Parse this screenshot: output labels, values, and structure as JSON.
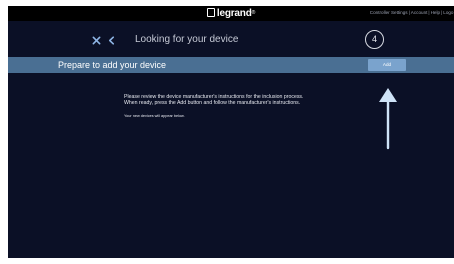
{
  "brand": {
    "name": "legrand",
    "registered_mark": "®"
  },
  "top_links": {
    "items": [
      "Controller Settings",
      "Account",
      "Help",
      "Logo"
    ],
    "separator": "|"
  },
  "header": {
    "close_icon": "close-icon",
    "back_icon": "chevron-left-icon",
    "title": "Looking for your device",
    "step": "4"
  },
  "prepare_bar": {
    "label": "Prepare to add your device",
    "add_button_label": "Add"
  },
  "instructions": {
    "line1": "Please review the device manufacturer's instructions for the inclusion process.",
    "line2": "When ready, press the Add button and follow the manufacturer's instructions.",
    "note": "Your new devices will appear below."
  },
  "colors": {
    "background": "#0b1026",
    "topbar": "#000000",
    "prepare_bar": "#4a6f93",
    "add_button": "#7aa3cd",
    "annotation_arrow": "#cfe3f7",
    "accent_close": "#8fb6e6"
  }
}
